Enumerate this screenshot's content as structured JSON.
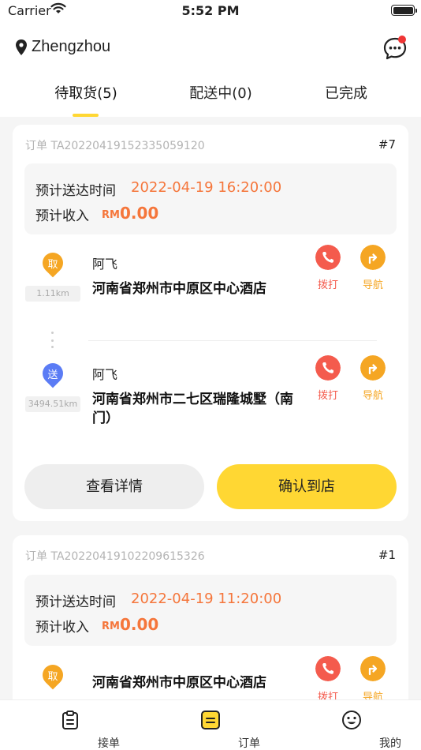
{
  "status_bar": {
    "carrier": "Carrier",
    "time": "5:52 PM"
  },
  "header": {
    "city": "Zhengzhou",
    "tabs": [
      {
        "label": "待取货(5)",
        "active": true
      },
      {
        "label": "配送中(0)",
        "active": false
      },
      {
        "label": "已完成",
        "active": false
      }
    ]
  },
  "orders": [
    {
      "order_no": "订单 TA20220419152335059120",
      "index": "#7",
      "eta_label": "预计送达时间",
      "eta": "2022-04-19 16:20:00",
      "income_label": "预计收入",
      "currency": "RM",
      "income": "0.00",
      "pickup": {
        "badge": "取",
        "distance": "1.11km",
        "name": "阿飞",
        "address": "河南省郑州市中原区中心酒店"
      },
      "delivery": {
        "badge": "送",
        "distance": "3494.51km",
        "name": "阿飞",
        "address": "河南省郑州市二七区瑞隆城墅（南门）"
      },
      "call_label": "拨打",
      "nav_label": "导航",
      "details_button": "查看详情",
      "confirm_button": "确认到店"
    },
    {
      "order_no": "订单 TA20220419102209615326",
      "index": "#1",
      "eta_label": "预计送达时间",
      "eta": "2022-04-19 11:20:00",
      "income_label": "预计收入",
      "currency": "RM",
      "income": "0.00",
      "pickup": {
        "badge": "取",
        "address": "河南省郑州市中原区中心酒店"
      },
      "call_label": "拨打",
      "nav_label": "导航"
    }
  ],
  "tabbar": [
    {
      "label": "接单",
      "icon": "clipboard-icon"
    },
    {
      "label": "订单",
      "icon": "order-list-icon",
      "active": true
    },
    {
      "label": "我的",
      "icon": "smiley-icon"
    }
  ],
  "colors": {
    "accent_yellow": "#ffd733",
    "orange": "#f5763b",
    "call_red": "#f45b4d",
    "pickup_pin": "#f5a623",
    "delivery_pin": "#5b7cf5"
  }
}
